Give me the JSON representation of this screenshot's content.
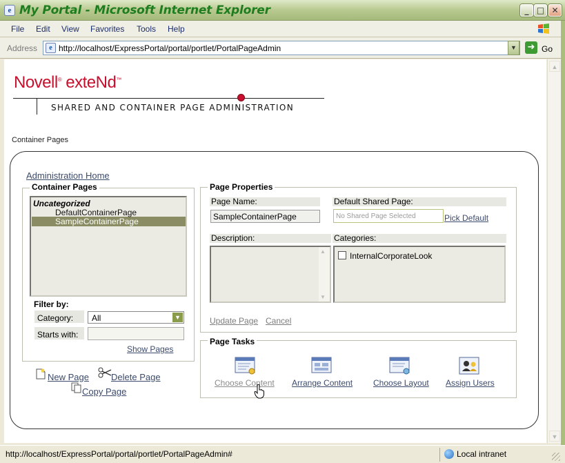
{
  "window": {
    "title": "My Portal - Microsoft Internet Explorer"
  },
  "menu": [
    "File",
    "Edit",
    "View",
    "Favorites",
    "Tools",
    "Help"
  ],
  "address": {
    "label": "Address",
    "url": "http://localhost/ExpressPortal/portal/portlet/PortalPageAdmin",
    "go_label": "Go"
  },
  "header": {
    "brand": "Novell",
    "brand_suffix": "exteNd",
    "subtitle": "SHARED AND CONTAINER PAGE ADMINISTRATION"
  },
  "breadcrumb": "Container Pages",
  "admin_home": "Administration Home",
  "container_pages": {
    "legend": "Container Pages",
    "category": "Uncategorized",
    "items": [
      "DefaultContainerPage",
      "SampleContainerPage"
    ],
    "selected": "SampleContainerPage",
    "filter_label": "Filter by:",
    "category_label": "Category:",
    "category_value": "All",
    "starts_with_label": "Starts with:",
    "starts_with_value": "",
    "show_pages": "Show Pages"
  },
  "actions": {
    "new_page": "New Page",
    "delete_page": "Delete Page",
    "copy_page": "Copy Page"
  },
  "page_properties": {
    "legend": "Page Properties",
    "page_name_label": "Page Name:",
    "page_name_value": "SampleContainerPage",
    "default_shared_label": "Default Shared Page:",
    "default_shared_placeholder": "No Shared Page Selected",
    "pick_default": "Pick Default",
    "description_label": "Description:",
    "categories_label": "Categories:",
    "categories": [
      {
        "name": "InternalCorporateLook",
        "checked": false
      }
    ],
    "update_page": "Update Page",
    "cancel": "Cancel"
  },
  "page_tasks": {
    "legend": "Page Tasks",
    "tasks": [
      "Choose Content",
      "Arrange Content",
      "Choose Layout",
      "Assign Users"
    ]
  },
  "status": {
    "url": "http://localhost/ExpressPortal/portal/portlet/PortalPageAdmin#",
    "zone": "Local intranet"
  },
  "colors": {
    "brand_red": "#c8102e",
    "link": "#3b4a6b",
    "selected_row": "#8a8d63"
  }
}
